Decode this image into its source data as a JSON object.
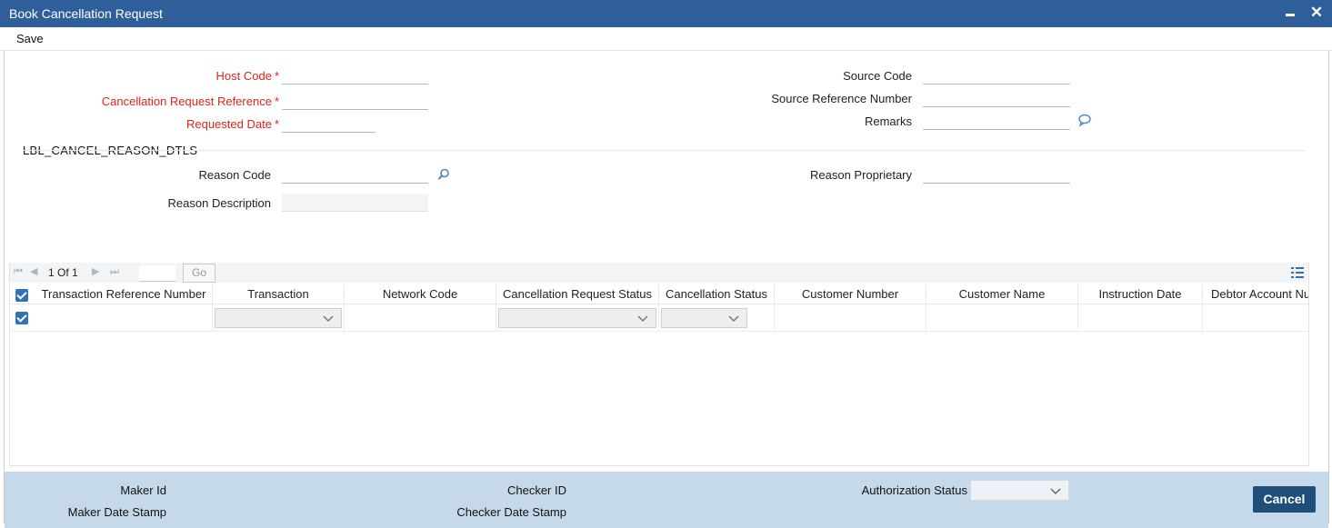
{
  "window": {
    "title": "Book Cancellation Request",
    "minimize_icon": "minimize-icon",
    "close_icon": "close-icon",
    "close_glyph": "✕"
  },
  "toolbar": {
    "save_label": "Save"
  },
  "form": {
    "host_code": {
      "label": "Host Code",
      "required_mark": "*",
      "value": ""
    },
    "cancellation_request_reference": {
      "label": "Cancellation Request Reference",
      "required_mark": "*",
      "value": ""
    },
    "requested_date": {
      "label": "Requested Date",
      "required_mark": "*",
      "value": ""
    },
    "source_code": {
      "label": "Source Code",
      "value": ""
    },
    "source_reference_number": {
      "label": "Source Reference Number",
      "value": ""
    },
    "remarks": {
      "label": "Remarks",
      "value": "",
      "icon": "comment-icon"
    }
  },
  "reason_section": {
    "title": "LBL_CANCEL_REASON_DTLS",
    "reason_code": {
      "label": "Reason Code",
      "value": "",
      "icon": "search-icon"
    },
    "reason_description": {
      "label": "Reason Description",
      "value": ""
    },
    "reason_proprietary": {
      "label": "Reason Proprietary",
      "value": ""
    }
  },
  "grid": {
    "pager": {
      "text": "1 Of 1",
      "go_label": "Go",
      "page_input": ""
    },
    "columns": [
      "Transaction Reference Number",
      "Transaction",
      "Network Code",
      "Cancellation Request Status",
      "Cancellation Status",
      "Customer Number",
      "Customer Name",
      "Instruction Date",
      "Debtor Account Nu"
    ],
    "rows": [
      {
        "checked": true,
        "transaction_reference_number": "",
        "transaction": "",
        "network_code": "",
        "cancellation_request_status": "",
        "cancellation_status": "",
        "customer_number": "",
        "customer_name": "",
        "instruction_date": "",
        "debtor_account_number": ""
      }
    ]
  },
  "footer": {
    "maker_id_label": "Maker Id",
    "maker_date_stamp_label": "Maker Date Stamp",
    "checker_id_label": "Checker ID",
    "checker_date_stamp_label": "Checker Date Stamp",
    "authorization_status_label": "Authorization Status",
    "authorization_status_value": "",
    "cancel_label": "Cancel"
  },
  "colors": {
    "titlebar": "#2f5f9a",
    "required": "#e2231a",
    "footer": "#c6d9ea",
    "cancel_button": "#1f4e7a",
    "checkbox": "#2f72b8"
  }
}
